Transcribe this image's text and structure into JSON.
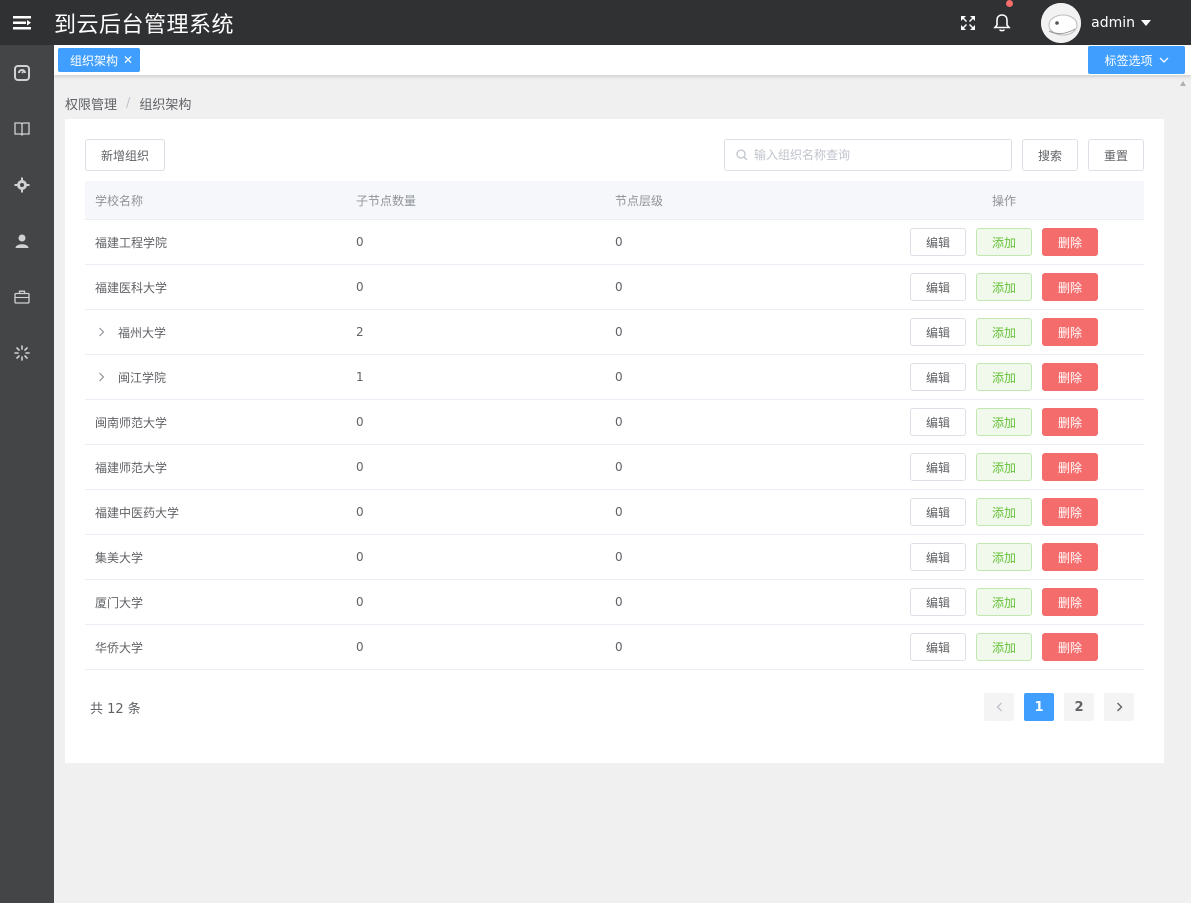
{
  "header": {
    "title": "到云后台管理系统",
    "user_name": "admin"
  },
  "tags": {
    "active_tag": "组织架构",
    "close_glyph": "✕",
    "options_label": "标签选项"
  },
  "breadcrumb": {
    "items": [
      "权限管理",
      "组织架构"
    ],
    "separator": "/"
  },
  "toolbar": {
    "add_label": "新增组织",
    "search_placeholder": "输入组织名称查询",
    "search_label": "搜索",
    "reset_label": "重置"
  },
  "table": {
    "columns": [
      "学校名称",
      "子节点数量",
      "节点层级",
      "操作"
    ],
    "actions": {
      "edit": "编辑",
      "add": "添加",
      "delete": "删除"
    },
    "rows": [
      {
        "name": "福建工程学院",
        "children": "0",
        "level": "0",
        "expandable": false
      },
      {
        "name": "福建医科大学",
        "children": "0",
        "level": "0",
        "expandable": false
      },
      {
        "name": "福州大学",
        "children": "2",
        "level": "0",
        "expandable": true
      },
      {
        "name": "闽江学院",
        "children": "1",
        "level": "0",
        "expandable": true
      },
      {
        "name": "闽南师范大学",
        "children": "0",
        "level": "0",
        "expandable": false
      },
      {
        "name": "福建师范大学",
        "children": "0",
        "level": "0",
        "expandable": false
      },
      {
        "name": "福建中医药大学",
        "children": "0",
        "level": "0",
        "expandable": false
      },
      {
        "name": "集美大学",
        "children": "0",
        "level": "0",
        "expandable": false
      },
      {
        "name": "厦门大学",
        "children": "0",
        "level": "0",
        "expandable": false
      },
      {
        "name": "华侨大学",
        "children": "0",
        "level": "0",
        "expandable": false
      }
    ]
  },
  "pagination": {
    "total_text": "共 12 条",
    "pages": [
      "1",
      "2"
    ],
    "current_page": "1"
  },
  "sidebar": {
    "icons": [
      "dashboard-icon",
      "book-icon",
      "settings-icon",
      "user-icon",
      "briefcase-icon",
      "loading-icon"
    ]
  },
  "colors": {
    "header_bg": "#303133",
    "sidebar_bg": "#444546",
    "primary": "#409eff",
    "success": "#67c23a",
    "danger": "#f56c6c"
  }
}
